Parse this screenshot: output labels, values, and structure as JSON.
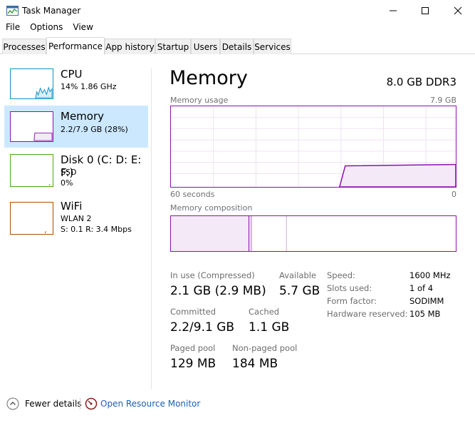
{
  "window": {
    "title": "Task Manager",
    "icons": {
      "app": "task-manager-icon",
      "minimize": "minimize-icon",
      "maximize": "maximize-icon",
      "close": "close-icon"
    }
  },
  "menu": [
    "File",
    "Options",
    "View"
  ],
  "tabs": [
    {
      "label": "Processes",
      "active": false
    },
    {
      "label": "Performance",
      "active": true
    },
    {
      "label": "App history",
      "active": false
    },
    {
      "label": "Startup",
      "active": false
    },
    {
      "label": "Users",
      "active": false
    },
    {
      "label": "Details",
      "active": false
    },
    {
      "label": "Services",
      "active": false
    }
  ],
  "resources": [
    {
      "title": "CPU",
      "line1": "14%  1.86 GHz",
      "line2": "",
      "line3": "",
      "color": "#1191c4",
      "selected": false
    },
    {
      "title": "Memory",
      "line1": "2.2/7.9 GB (28%)",
      "line2": "",
      "line3": "",
      "color": "#8b12ae",
      "selected": true
    },
    {
      "title": "Disk 0 (C: D: E: F:)",
      "line1": "SSD",
      "line2": "0%",
      "line3": "",
      "color": "#4da60c",
      "selected": false
    },
    {
      "title": "WiFi",
      "line1": "WLAN 2",
      "line2": "S: 0.1  R: 3.4 Mbps",
      "line3": "",
      "color": "#a74f01",
      "selected": false
    }
  ],
  "main": {
    "title": "Memory",
    "spec": "8.0 GB DDR3",
    "usage_label": "Memory usage",
    "usage_max": "7.9 GB",
    "time_left": "60 seconds",
    "time_right": "0",
    "composition_label": "Memory composition",
    "usage_fraction_current": 0.28,
    "accent": "#8b12ae",
    "stats": {
      "in_use_label": "In use (Compressed)",
      "in_use_value": "2.1 GB (2.9 MB)",
      "available_label": "Available",
      "available_value": "5.7 GB",
      "committed_label": "Committed",
      "committed_value": "2.2/9.1 GB",
      "cached_label": "Cached",
      "cached_value": "1.1 GB",
      "paged_label": "Paged pool",
      "paged_value": "129 MB",
      "nonpaged_label": "Non-paged pool",
      "nonpaged_value": "184 MB"
    },
    "info": [
      {
        "label": "Speed:",
        "value": "1600 MHz"
      },
      {
        "label": "Slots used:",
        "value": "1 of 4"
      },
      {
        "label": "Form factor:",
        "value": "SODIMM"
      },
      {
        "label": "Hardware reserved:",
        "value": "105 MB"
      }
    ]
  },
  "footer": {
    "fewer_details": "Fewer details",
    "open_monitor": "Open Resource Monitor",
    "icons": {
      "fewer": "chevron-up-circle-icon",
      "monitor": "resource-monitor-icon"
    }
  }
}
